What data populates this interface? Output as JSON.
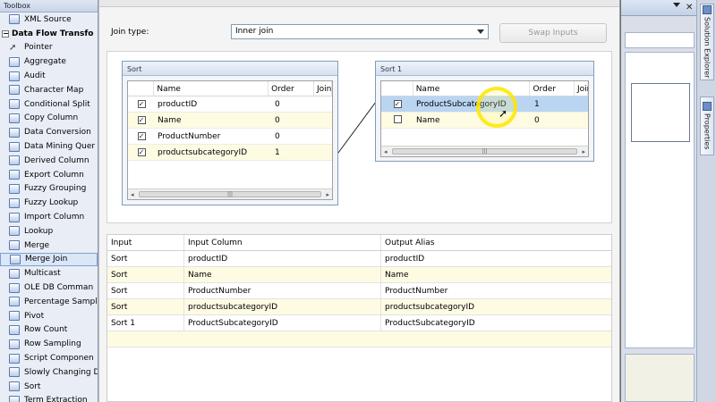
{
  "toolbox": {
    "title": "Toolbox",
    "items": [
      {
        "label": "XML Source"
      },
      {
        "label": "Data Flow Transfo",
        "header": true
      },
      {
        "label": "Pointer",
        "pointer": true
      },
      {
        "label": "Aggregate"
      },
      {
        "label": "Audit"
      },
      {
        "label": "Character Map"
      },
      {
        "label": "Conditional Split"
      },
      {
        "label": "Copy Column"
      },
      {
        "label": "Data Conversion"
      },
      {
        "label": "Data Mining Quer"
      },
      {
        "label": "Derived Column"
      },
      {
        "label": "Export Column"
      },
      {
        "label": "Fuzzy Grouping"
      },
      {
        "label": "Fuzzy Lookup"
      },
      {
        "label": "Import Column"
      },
      {
        "label": "Lookup"
      },
      {
        "label": "Merge"
      },
      {
        "label": "Merge Join",
        "selected": true
      },
      {
        "label": "Multicast"
      },
      {
        "label": "OLE DB Comman"
      },
      {
        "label": "Percentage Sampl"
      },
      {
        "label": "Pivot"
      },
      {
        "label": "Row Count"
      },
      {
        "label": "Row Sampling"
      },
      {
        "label": "Script Componen"
      },
      {
        "label": "Slowly Changing D"
      },
      {
        "label": "Sort"
      },
      {
        "label": "Term Extraction"
      }
    ]
  },
  "dialog": {
    "join_type_label": "Join type:",
    "join_type_value": "Inner join",
    "swap_button": "Swap Inputs"
  },
  "left_table": {
    "title": "Sort",
    "columns": [
      "Name",
      "Order",
      "Join"
    ],
    "rows": [
      {
        "checked": true,
        "name": "productID",
        "order": "0"
      },
      {
        "checked": true,
        "name": "Name",
        "order": "0"
      },
      {
        "checked": true,
        "name": "ProductNumber",
        "order": "0"
      },
      {
        "checked": true,
        "name": "productsubcategoryID",
        "order": "1"
      }
    ]
  },
  "right_table": {
    "title": "Sort 1",
    "columns": [
      "Name",
      "Order",
      "Join"
    ],
    "rows": [
      {
        "checked": true,
        "name": "ProductSubcategoryID",
        "order": "1"
      },
      {
        "checked": false,
        "name": "Name",
        "order": "0"
      }
    ]
  },
  "output": {
    "columns": [
      "Input",
      "Input Column",
      "Output Alias"
    ],
    "rows": [
      {
        "input": "Sort",
        "column": "productID",
        "alias": "productID"
      },
      {
        "input": "Sort",
        "column": "Name",
        "alias": "Name"
      },
      {
        "input": "Sort",
        "column": "ProductNumber",
        "alias": "ProductNumber"
      },
      {
        "input": "Sort",
        "column": "productsubcategoryID",
        "alias": "productsubcategoryID"
      },
      {
        "input": "Sort 1",
        "column": "ProductSubcategoryID",
        "alias": "ProductSubcategoryID"
      }
    ]
  },
  "side_tabs": {
    "solution_explorer": "Solution Explorer",
    "properties": "Properties"
  },
  "colors": {
    "accent": "#7aa0d6",
    "selected_row": "#b9d5f2",
    "alt_row": "#fefbe3",
    "highlight": "#ffe600"
  }
}
